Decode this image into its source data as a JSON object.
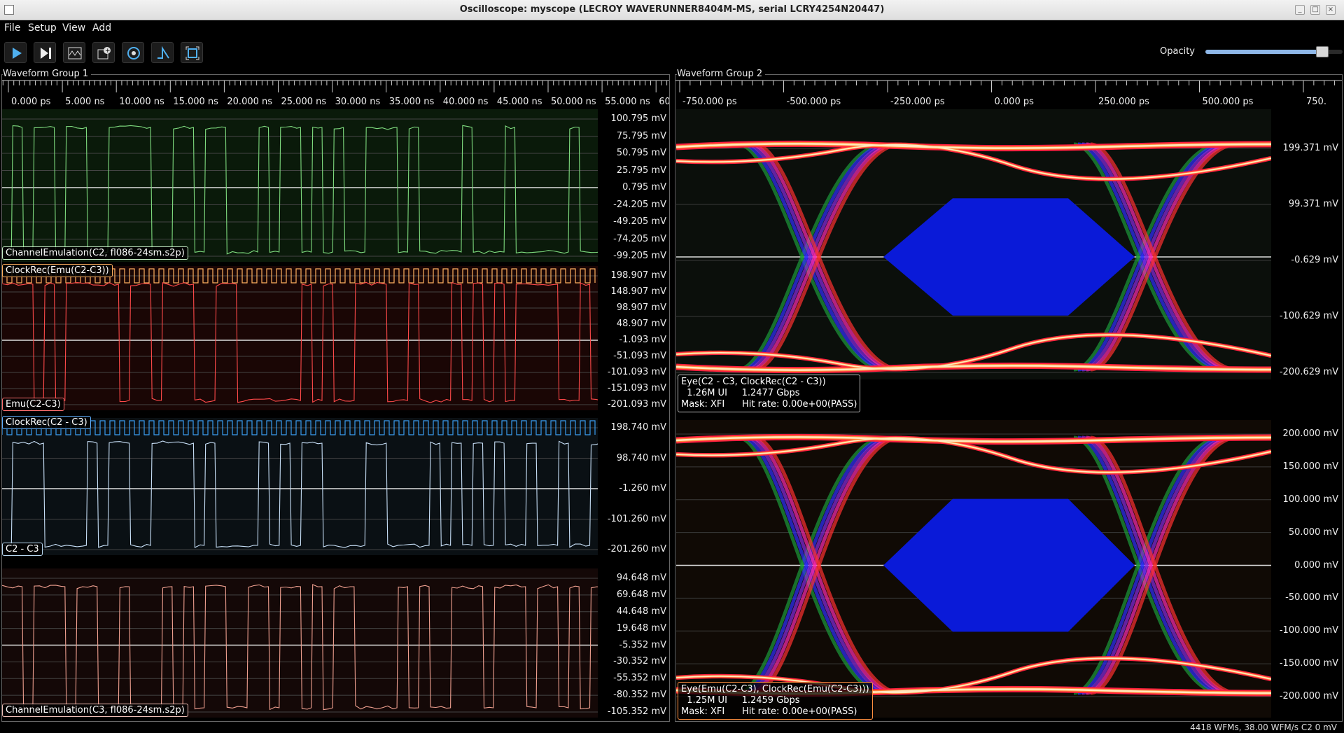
{
  "window": {
    "title": "Oscilloscope: myscope (LECROY WAVERUNNER8404M-MS, serial LCRY4254N20447)"
  },
  "menu": [
    "File",
    "Setup",
    "View",
    "Add"
  ],
  "toolbar": {
    "buttons": [
      "play-icon",
      "step-icon",
      "waveform-icon",
      "add-measure-icon",
      "settings-icon",
      "trigger-icon",
      "fullscreen-icon"
    ],
    "opacity_label": "Opacity",
    "opacity_value": 0.85
  },
  "group1": {
    "title": "Waveform Group 1",
    "time_ticks": [
      "0.000 ps",
      "5.000 ns",
      "10.000 ns",
      "15.000 ns",
      "20.000 ns",
      "25.000 ns",
      "30.000 ns",
      "35.000 ns",
      "40.000 ns",
      "45.000 ns",
      "50.000 ns",
      "55.000 ns",
      "60"
    ],
    "panels": [
      {
        "labels": [
          "ChannelEmulation(C2, fl086-24sm.s2p)"
        ],
        "label_colors": [
          "#c8f0c8"
        ],
        "trace_color": "#7fdc7f",
        "bg": "#0a1a0a",
        "volts": [
          "100.795 mV",
          "75.795 mV",
          "50.795 mV",
          "25.795 mV",
          "0.795 mV",
          "-24.205 mV",
          "-49.205 mV",
          "-74.205 mV",
          "-99.205 mV"
        ]
      },
      {
        "labels": [
          "ClockRec(Emu(C2-C3))",
          "Emu(C2-C3)"
        ],
        "label_colors": [
          "#ffb060",
          "#ff7070"
        ],
        "trace_color": "#ff4a4a",
        "clock_color": "#ffb060",
        "bg": "#1a0605",
        "volts": [
          "198.907 mV",
          "148.907 mV",
          "98.907 mV",
          "48.907 mV",
          "-1.093 mV",
          "-51.093 mV",
          "-101.093 mV",
          "-151.093 mV",
          "-201.093 mV"
        ]
      },
      {
        "labels": [
          "ClockRec(C2 - C3)",
          "C2 - C3"
        ],
        "label_colors": [
          "#60b0ff",
          "#b8d8f0"
        ],
        "trace_color": "#c8e0f8",
        "clock_color": "#3a9cf0",
        "bg": "#0a1014",
        "volts": [
          "198.740 mV",
          "98.740 mV",
          "-1.260 mV",
          "-101.260 mV",
          "-201.260 mV"
        ]
      },
      {
        "labels": [
          "ChannelEmulation(C3, fl086-24sm.s2p)"
        ],
        "label_colors": [
          "#f0c0b8"
        ],
        "trace_color": "#f0a090",
        "bg": "#140807",
        "volts": [
          "94.648 mV",
          "69.648 mV",
          "44.648 mV",
          "19.648 mV",
          "-5.352 mV",
          "-30.352 mV",
          "-55.352 mV",
          "-80.352 mV",
          "-105.352 mV"
        ]
      }
    ]
  },
  "group2": {
    "title": "Waveform Group 2",
    "time_ticks": [
      "-750.000 ps",
      "-500.000 ps",
      "-250.000 ps",
      "0.000 ps",
      "250.000 ps",
      "500.000 ps",
      "750."
    ],
    "eyes": [
      {
        "volts": [
          "199.371 mV",
          "99.371 mV",
          "-0.629 mV",
          "-100.629 mV",
          "-200.629 mV"
        ],
        "info_line1": "Eye(C2 - C3, ClockRec(C2 - C3))",
        "info_line2": "  1.26M UI     1.2477 Gbps",
        "info_line3": "Mask: XFI      Hit rate: 0.00e+00(PASS)",
        "border_color": "#bbbbbb",
        "bg": "#0b0f0b"
      },
      {
        "volts": [
          "200.000 mV",
          "150.000 mV",
          "100.000 mV",
          "50.000 mV",
          "0.000 mV",
          "-50.000 mV",
          "-100.000 mV",
          "-150.000 mV",
          "-200.000 mV"
        ],
        "info_line1": "Eye(Emu(C2-C3), ClockRec(Emu(C2-C3)))",
        "info_line2": "  1.25M UI     1.2459 Gbps",
        "info_line3": "Mask: XFI      Hit rate: 0.00e+00(PASS)",
        "border_color": "#ff9040",
        "bg": "#100a05"
      }
    ]
  },
  "status": "4418 WFMs, 38.00 WFM/s    C2 0 mV"
}
